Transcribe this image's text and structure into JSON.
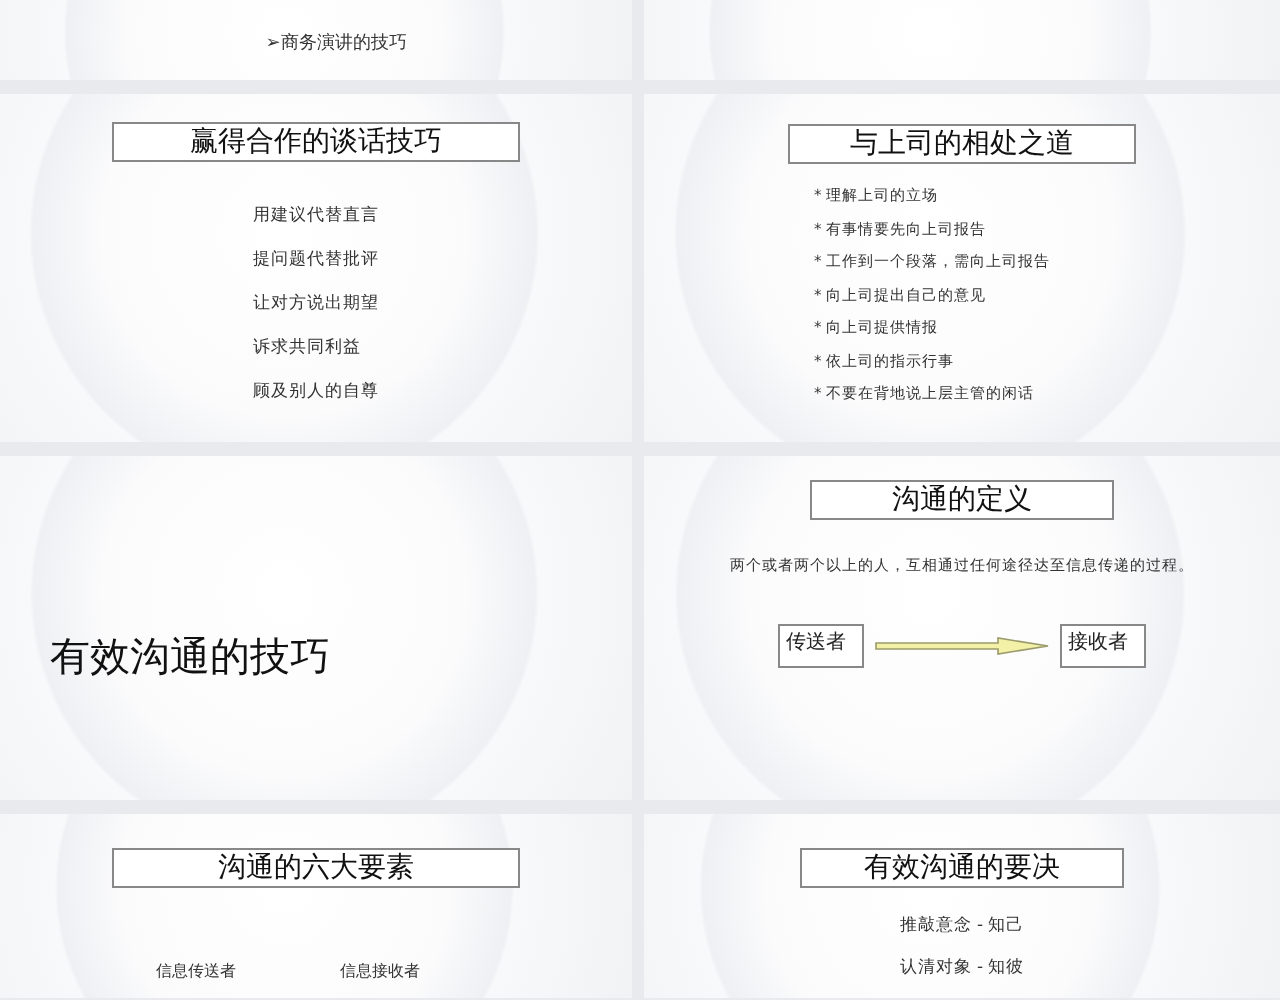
{
  "slides": [
    {
      "kind": "list",
      "items": [
        "➢商务演讲的技巧"
      ]
    },
    {
      "kind": "blank"
    },
    {
      "kind": "titled-list",
      "title": "赢得合作的谈话技巧",
      "items": [
        "用建议代替直言",
        "提问题代替批评",
        "让对方说出期望",
        "诉求共同利益",
        "顾及别人的自尊"
      ]
    },
    {
      "kind": "bullets",
      "title": "与上司的相处之道",
      "items": [
        "* 理解上司的立场",
        "* 有事情要先向上司报告",
        "* 工作到一个段落，需向上司报告",
        "* 向上司提出自己的意见",
        "* 向上司提供情报",
        "* 依上司的指示行事",
        "* 不要在背地说上层主管的闲话"
      ]
    },
    {
      "kind": "section",
      "title": "有效沟通的技巧"
    },
    {
      "kind": "definition",
      "title": "沟通的定义",
      "text": "两个或者两个以上的人，互相通过任何途径达至信息传递的过程。",
      "sender": "传送者",
      "receiver": "接收者"
    },
    {
      "kind": "pairs",
      "title": "沟通的六大要素",
      "items": [
        "信息传送者",
        "信息接收者"
      ]
    },
    {
      "kind": "titled-list",
      "title": "有效沟通的要决",
      "items": [
        "推敲意念 - 知己",
        "认清对象 - 知彼"
      ]
    }
  ]
}
